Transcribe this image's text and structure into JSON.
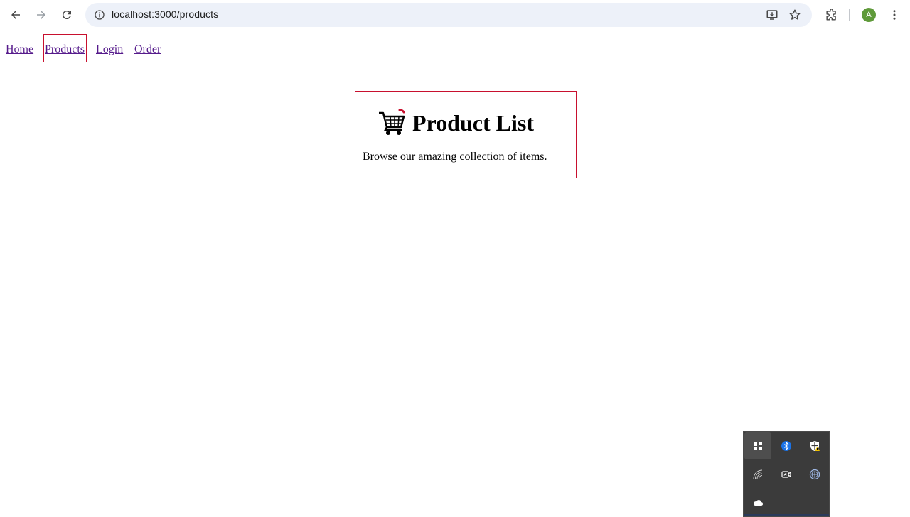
{
  "browser": {
    "url": "localhost:3000/products",
    "profile_initial": "A",
    "icons": {
      "back": "arrow-left-icon",
      "forward": "arrow-right-icon",
      "reload": "reload-icon",
      "site_info": "info-icon",
      "install": "install-app-icon",
      "bookmark": "star-icon",
      "extensions": "puzzle-icon",
      "menu": "kebab-menu-icon"
    }
  },
  "nav": {
    "links": [
      {
        "label": "Home"
      },
      {
        "label": "Products",
        "active": true
      },
      {
        "label": "Login"
      },
      {
        "label": "Order"
      }
    ]
  },
  "card": {
    "icon": "shopping-cart-icon",
    "title": "Product List",
    "description": "Browse our amazing collection of items."
  },
  "tray": {
    "icons": [
      "windows-security-app-icon",
      "bluetooth-icon",
      "defender-warning-icon",
      "network-icon",
      "meet-now-icon",
      "vpn-globe-icon",
      "onedrive-cloud-icon"
    ]
  },
  "colors": {
    "accent_border": "#c8102e",
    "visited_link": "#551a8b",
    "omnibox_bg": "#edf1f9",
    "avatar_bg": "#5f9a3a",
    "tray_bg": "#3b3b3b",
    "bluetooth": "#1a73e8"
  }
}
